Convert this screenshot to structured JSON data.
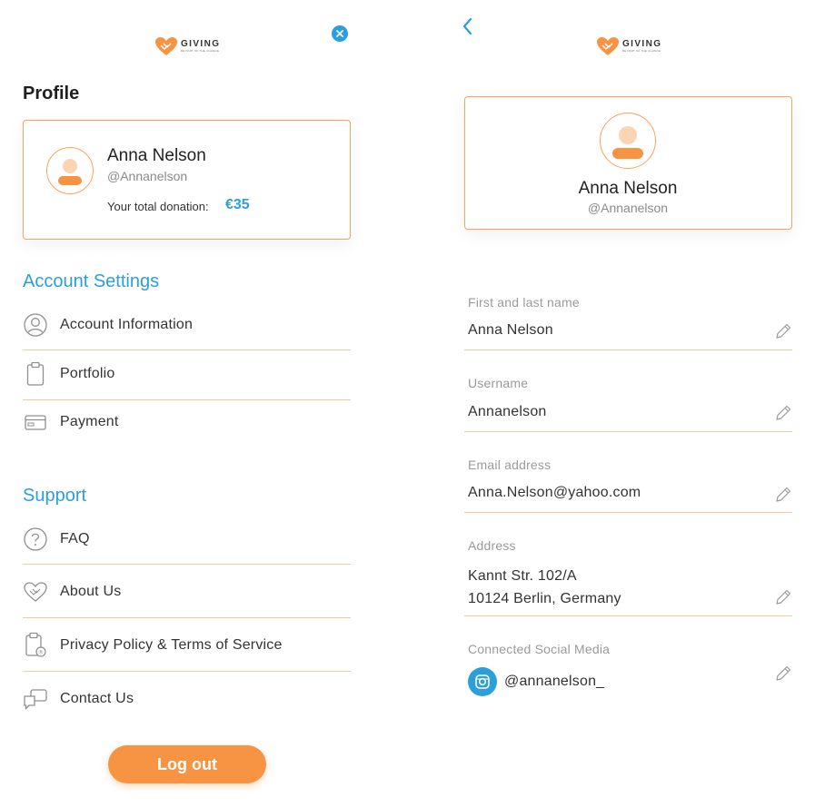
{
  "brand": {
    "name": "GIVING",
    "tagline": "BE PART OF THE CHANGE"
  },
  "left": {
    "title": "Profile",
    "profile": {
      "name": "Anna Nelson",
      "handle": "@Annanelson",
      "donation_label": "Your total donation:",
      "donation_value": "€35"
    },
    "account_settings": {
      "title": "Account Settings",
      "items": [
        {
          "label": "Account Information",
          "icon": "user-circle-icon"
        },
        {
          "label": "Portfolio",
          "icon": "clipboard-icon"
        },
        {
          "label": "Payment",
          "icon": "credit-card-icon"
        }
      ]
    },
    "support": {
      "title": "Support",
      "items": [
        {
          "label": "FAQ",
          "icon": "question-circle-icon"
        },
        {
          "label": "About Us",
          "icon": "heart-handshake-icon"
        },
        {
          "label": "Privacy Policy & Terms of Service",
          "icon": "document-lock-icon"
        },
        {
          "label": "Contact Us",
          "icon": "chat-bubbles-icon"
        }
      ]
    },
    "logout_label": "Log out"
  },
  "right": {
    "profile": {
      "name": "Anna Nelson",
      "handle": "@Annanelson"
    },
    "fields": [
      {
        "label": "First and last name",
        "value": "Anna Nelson"
      },
      {
        "label": "Username",
        "value": "Annanelson"
      },
      {
        "label": "Email address",
        "value": "Anna.Nelson@yahoo.com"
      },
      {
        "label": "Address",
        "value_line1": "Kannt Str. 102/A",
        "value_line2": "10124 Berlin, Germany"
      },
      {
        "label": "Connected Social Media",
        "value": "@annanelson_",
        "icon": "instagram-icon"
      }
    ]
  },
  "colors": {
    "accent": "#f79443",
    "border": "#f7a35c",
    "blue": "#2b9fdc",
    "divider": "#f9c79a"
  }
}
